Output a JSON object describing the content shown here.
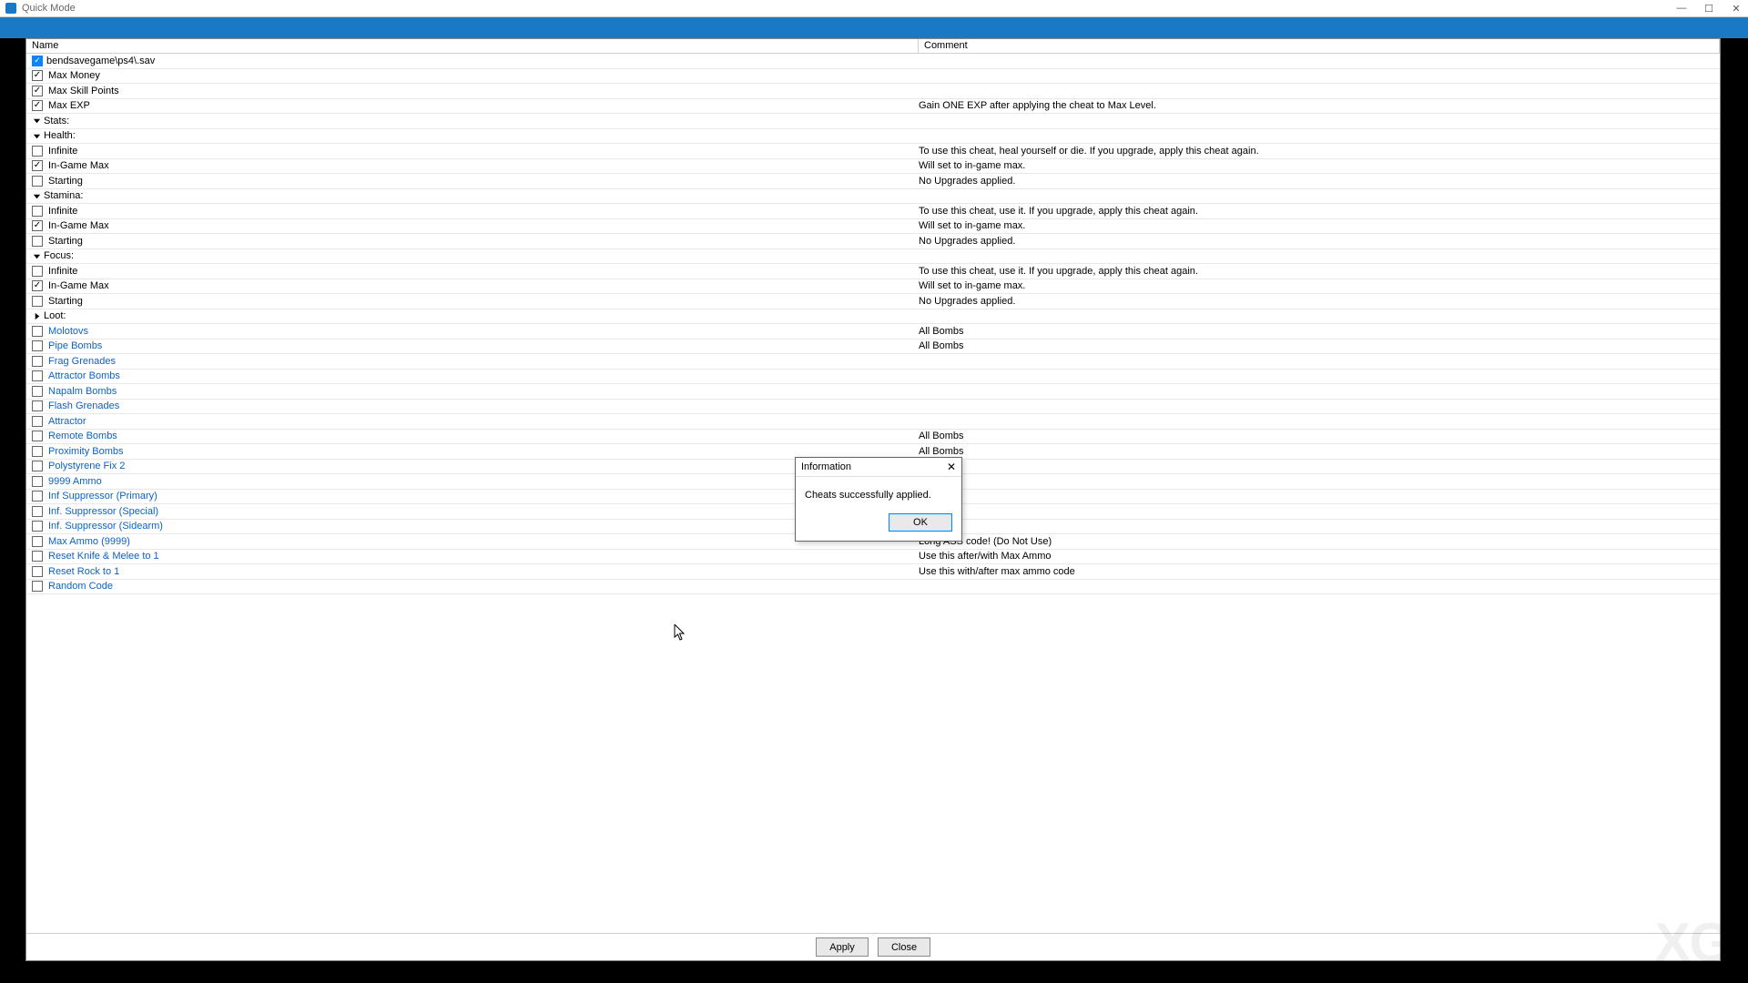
{
  "window": {
    "title": "Quick Mode",
    "min": "—",
    "max": "☐",
    "close": "✕"
  },
  "columns": {
    "name": "Name",
    "comment": "Comment"
  },
  "root": {
    "label": "bendsavegame\\ps4\\.sav"
  },
  "rows": [
    {
      "indent": "ind1",
      "cb": true,
      "checked": true,
      "label": "Max Money",
      "comment": ""
    },
    {
      "indent": "ind1",
      "cb": true,
      "checked": true,
      "label": "Max Skill Points",
      "comment": ""
    },
    {
      "indent": "ind1",
      "cb": true,
      "checked": true,
      "label": "Max EXP",
      "comment": "Gain ONE EXP after applying the cheat to Max Level."
    },
    {
      "indent": "ind1b",
      "tw": "down",
      "label": "Stats:",
      "comment": ""
    },
    {
      "indent": "ind2",
      "tw": "down",
      "label": "Health:",
      "comment": ""
    },
    {
      "indent": "ind3",
      "cb": true,
      "checked": false,
      "label": "Infinite",
      "comment": "To use this cheat, heal yourself or die. If you upgrade, apply this cheat again."
    },
    {
      "indent": "ind3",
      "cb": true,
      "checked": true,
      "label": "In-Game Max",
      "comment": "Will set to in-game max."
    },
    {
      "indent": "ind3",
      "cb": true,
      "checked": false,
      "label": "Starting",
      "comment": "No Upgrades applied."
    },
    {
      "indent": "ind2",
      "tw": "down",
      "label": "Stamina:",
      "comment": ""
    },
    {
      "indent": "ind3",
      "cb": true,
      "checked": false,
      "label": "Infinite",
      "comment": "To use this cheat, use it. If you upgrade, apply this cheat again."
    },
    {
      "indent": "ind3",
      "cb": true,
      "checked": true,
      "label": "In-Game Max",
      "comment": "Will set to in-game max."
    },
    {
      "indent": "ind3",
      "cb": true,
      "checked": false,
      "label": "Starting",
      "comment": "No Upgrades applied."
    },
    {
      "indent": "ind2",
      "tw": "down",
      "label": "Focus:",
      "comment": ""
    },
    {
      "indent": "ind3",
      "cb": true,
      "checked": false,
      "label": "Infinite",
      "comment": "To use this cheat, use it. If you upgrade, apply this cheat again."
    },
    {
      "indent": "ind3",
      "cb": true,
      "checked": true,
      "label": "In-Game Max",
      "comment": "Will set to in-game max."
    },
    {
      "indent": "ind3",
      "cb": true,
      "checked": false,
      "label": "Starting",
      "comment": "No Upgrades applied."
    },
    {
      "indent": "ind1b",
      "tw": "right",
      "label": "Loot:",
      "comment": ""
    },
    {
      "indent": "ind1",
      "cb": true,
      "checked": false,
      "link": true,
      "label": "Molotovs",
      "comment": "All Bombs"
    },
    {
      "indent": "ind1",
      "cb": true,
      "checked": false,
      "link": true,
      "label": "Pipe Bombs",
      "comment": "All Bombs"
    },
    {
      "indent": "ind1",
      "cb": true,
      "checked": false,
      "link": true,
      "label": "Frag Grenades",
      "comment": ""
    },
    {
      "indent": "ind1",
      "cb": true,
      "checked": false,
      "link": true,
      "label": "Attractor Bombs",
      "comment": ""
    },
    {
      "indent": "ind1",
      "cb": true,
      "checked": false,
      "link": true,
      "label": "Napalm Bombs",
      "comment": ""
    },
    {
      "indent": "ind1",
      "cb": true,
      "checked": false,
      "link": true,
      "label": "Flash Grenades",
      "comment": ""
    },
    {
      "indent": "ind1",
      "cb": true,
      "checked": false,
      "link": true,
      "label": "Attractor",
      "comment": ""
    },
    {
      "indent": "ind1",
      "cb": true,
      "checked": false,
      "link": true,
      "label": "Remote Bombs",
      "comment": "All Bombs"
    },
    {
      "indent": "ind1",
      "cb": true,
      "checked": false,
      "link": true,
      "label": "Proximity Bombs",
      "comment": "All Bombs"
    },
    {
      "indent": "ind1",
      "cb": true,
      "checked": false,
      "link": true,
      "label": "Polystyrene Fix 2",
      "comment": ""
    },
    {
      "indent": "ind1",
      "cb": true,
      "checked": false,
      "link": true,
      "label": "9999 Ammo",
      "comment": ""
    },
    {
      "indent": "ind1",
      "cb": true,
      "checked": false,
      "link": true,
      "label": "Inf Suppressor (Primary)",
      "comment": ""
    },
    {
      "indent": "ind1",
      "cb": true,
      "checked": false,
      "link": true,
      "label": "Inf. Suppressor (Special)",
      "comment": ""
    },
    {
      "indent": "ind1",
      "cb": true,
      "checked": false,
      "link": true,
      "label": "Inf. Suppressor (Sidearm)",
      "comment": ""
    },
    {
      "indent": "ind1",
      "cb": true,
      "checked": false,
      "link": true,
      "label": "Max Ammo (9999)",
      "comment": "Long ASS code! (Do Not Use)"
    },
    {
      "indent": "ind1",
      "cb": true,
      "checked": false,
      "link": true,
      "label": "Reset Knife & Melee to 1",
      "comment": "Use this after/with Max Ammo"
    },
    {
      "indent": "ind1",
      "cb": true,
      "checked": false,
      "link": true,
      "label": "Reset Rock to 1",
      "comment": "Use this with/after max ammo code"
    },
    {
      "indent": "ind1",
      "cb": true,
      "checked": false,
      "link": true,
      "label": "Random Code",
      "comment": ""
    }
  ],
  "buttons": {
    "apply": "Apply",
    "close": "Close"
  },
  "dialog": {
    "title": "Information",
    "message": "Cheats successfully applied.",
    "ok": "OK",
    "x": "✕"
  },
  "watermark": "XG"
}
